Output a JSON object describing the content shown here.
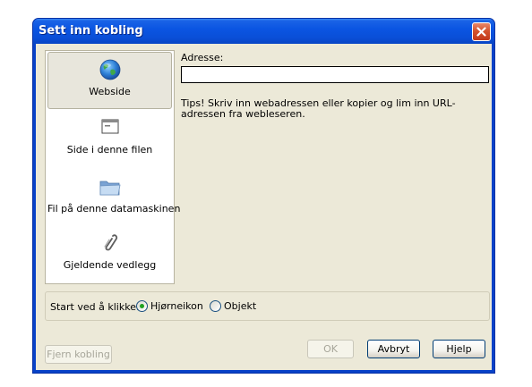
{
  "window": {
    "title": "Sett inn kobling"
  },
  "nav": {
    "items": [
      {
        "label": "Webside",
        "icon": "globe-icon",
        "selected": true
      },
      {
        "label": "Side i denne filen",
        "icon": "page-window-icon",
        "selected": false
      },
      {
        "label": "Fil på denne datamaskinen",
        "icon": "folder-icon",
        "selected": false
      },
      {
        "label": "Gjeldende vedlegg",
        "icon": "paperclip-icon",
        "selected": false
      }
    ]
  },
  "address": {
    "label": "Adresse:",
    "value": "",
    "tips": "Tips!  Skriv inn webadressen eller kopier og lim inn URL-adressen fra webleseren."
  },
  "start": {
    "label": "Start ved å klikke:",
    "options": [
      {
        "label": "Hjørneikon",
        "checked": true
      },
      {
        "label": "Objekt",
        "checked": false
      }
    ]
  },
  "buttons": {
    "remove_label": "Fjern kobling",
    "ok_label": "OK",
    "cancel_label": "Avbryt",
    "help_label": "Hjelp"
  },
  "colors": {
    "titlebar": "#0a53db",
    "client_bg": "#ece9d8",
    "close_button": "#d4532d",
    "radio_checked": "#21a121"
  }
}
